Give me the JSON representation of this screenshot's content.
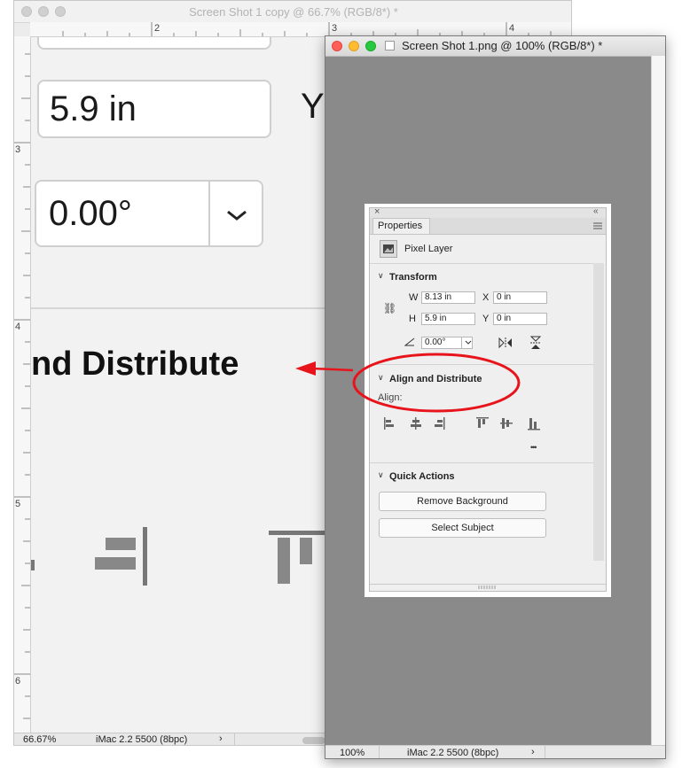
{
  "back_window": {
    "title": "Screen Shot 1 copy @ 66.7% (RGB/8*) *",
    "ruler_top": [
      "2",
      "3",
      "4"
    ],
    "ruler_left": [
      "3",
      "4",
      "5",
      "6"
    ],
    "height_value": "5.9 in",
    "y_label": "Y",
    "angle_value": "0.00°",
    "section_fragment": "nd Distribute",
    "status_zoom": "66.67%",
    "status_profile": "iMac 2.2 5500 (8bpc)",
    "status_arrow": "›"
  },
  "front_window": {
    "title": "Screen Shot 1.png @ 100% (RGB/8*) *",
    "status_zoom": "100%",
    "status_profile": "iMac 2.2 5500 (8bpc)",
    "status_arrow": "›"
  },
  "properties": {
    "tab": "Properties",
    "layer_type": "Pixel Layer",
    "transform": {
      "title": "Transform",
      "w_label": "W",
      "w_value": "8.13 in",
      "h_label": "H",
      "h_value": "5.9 in",
      "x_label": "X",
      "x_value": "0 in",
      "y_label": "Y",
      "y_value": "0 in",
      "angle_value": "0.00°"
    },
    "align": {
      "title": "Align and Distribute",
      "label": "Align:",
      "more": "•••"
    },
    "quick_actions": {
      "title": "Quick Actions",
      "remove_background": "Remove Background",
      "select_subject": "Select Subject"
    }
  },
  "annotation": {
    "color": "#e8141c"
  }
}
